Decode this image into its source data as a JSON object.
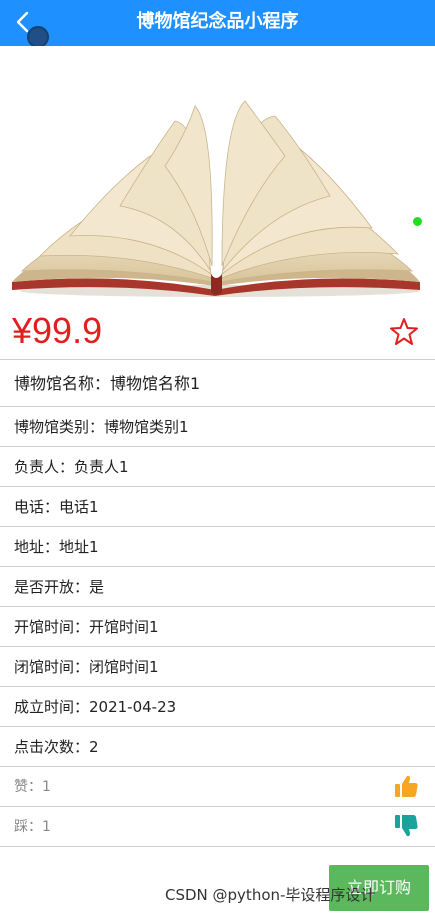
{
  "header": {
    "title": "博物馆纪念品小程序",
    "back_icon": "chevron-left-icon"
  },
  "product": {
    "price": "¥99.9",
    "favorite_icon": "star-outline-icon"
  },
  "details": [
    {
      "text": "博物馆名称：博物馆名称1"
    },
    {
      "text": "博物馆类别：博物馆类别1"
    },
    {
      "text": "负责人：负责人1"
    },
    {
      "text": "电话：电话1"
    },
    {
      "text": "地址：地址1"
    },
    {
      "text": "是否开放：是"
    },
    {
      "text": "开馆时间：开馆时间1"
    },
    {
      "text": "闭馆时间：闭馆时间1"
    },
    {
      "text": "成立时间：2021-04-23"
    },
    {
      "text": "点击次数：2"
    }
  ],
  "reactions": {
    "like": {
      "text": "赞：1",
      "icon": "thumbs-up-icon",
      "color": "#f5a623"
    },
    "dislike": {
      "text": "踩：1",
      "icon": "thumbs-down-icon",
      "color": "#1aa39a"
    }
  },
  "actions": {
    "buy_label": "立即订购"
  },
  "watermark": "CSDN @python-毕设程序设计",
  "colors": {
    "nav": "#1e90ff",
    "price": "#e21f1f",
    "buy": "#5cb85c"
  }
}
